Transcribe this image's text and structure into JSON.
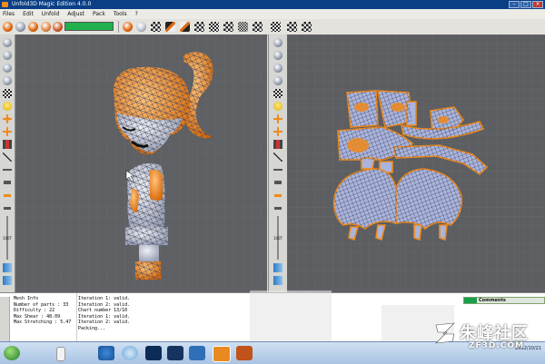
{
  "window": {
    "title": "Unfold3D Magic Edition 4.0.0",
    "controls": [
      "minimize-icon",
      "maximize-icon",
      "close-icon"
    ]
  },
  "menu": {
    "items": [
      "Files",
      "Edit",
      "Unfold",
      "Adjust",
      "Pack",
      "Tools",
      "?"
    ]
  },
  "toolbar": {
    "progress_fraction": 1.0,
    "progress_color": "#22b14c"
  },
  "mesh_info": {
    "title": "Mesh Info",
    "rows": [
      {
        "label": "Number of parts",
        "value": "33"
      },
      {
        "label": "Difficulty",
        "value": "22"
      },
      {
        "label": "Max Shear",
        "value": "48.09"
      },
      {
        "label": "Max Stretching",
        "value": "5.47"
      }
    ]
  },
  "log": {
    "lines": [
      "Iteration 1: valid.",
      "Iteration 2: valid.",
      "Chart number 13/10",
      "Iteration 1: valid.",
      "Iteration 2: valid.",
      "Packing..."
    ]
  },
  "comments": {
    "label": "Comments"
  },
  "side_labels": {
    "left_zoom": "100T",
    "mid_zoom": "100T"
  },
  "taskbar": {
    "date": "2012/10/21"
  },
  "watermark": {
    "brand": "朱峰社区",
    "url": "ZF3D.COM"
  },
  "colors": {
    "viewport_bg": "#5e6063",
    "mesh_fill": "#c9ccd6",
    "uv_border": "#f08a1c",
    "accent_orange": "#f08a1c",
    "title_blue": "#0a3f86"
  }
}
